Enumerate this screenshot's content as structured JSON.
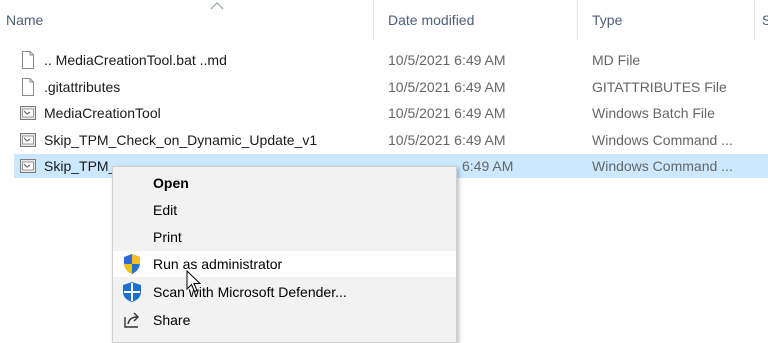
{
  "columns": {
    "name": "Name",
    "date_modified": "Date modified",
    "type": "Type",
    "size_partial": "S"
  },
  "files": [
    {
      "name": ".. MediaCreationTool.bat ..md",
      "date": "10/5/2021 6:49 AM",
      "type": "MD File",
      "icon": "blank-file-icon"
    },
    {
      "name": ".gitattributes",
      "date": "10/5/2021 6:49 AM",
      "type": "GITATTRIBUTES File",
      "icon": "blank-file-icon"
    },
    {
      "name": "MediaCreationTool",
      "date": "10/5/2021 6:49 AM",
      "type": "Windows Batch File",
      "icon": "batch-file-icon"
    },
    {
      "name": "Skip_TPM_Check_on_Dynamic_Update_v1",
      "date": "10/5/2021 6:49 AM",
      "type": "Windows Command ...",
      "icon": "batch-file-icon"
    },
    {
      "name": "Skip_TPM_",
      "date": "6:49 AM",
      "type": "Windows Command ...",
      "icon": "batch-file-icon",
      "selected": true
    }
  ],
  "context_menu": {
    "open": "Open",
    "edit": "Edit",
    "print": "Print",
    "run_as_admin": "Run as administrator",
    "scan_defender": "Scan with Microsoft Defender...",
    "share": "Share"
  },
  "colors": {
    "selection": "#cce8ff",
    "header_text": "#4c607a",
    "menu_bg": "#f2f2f2"
  }
}
